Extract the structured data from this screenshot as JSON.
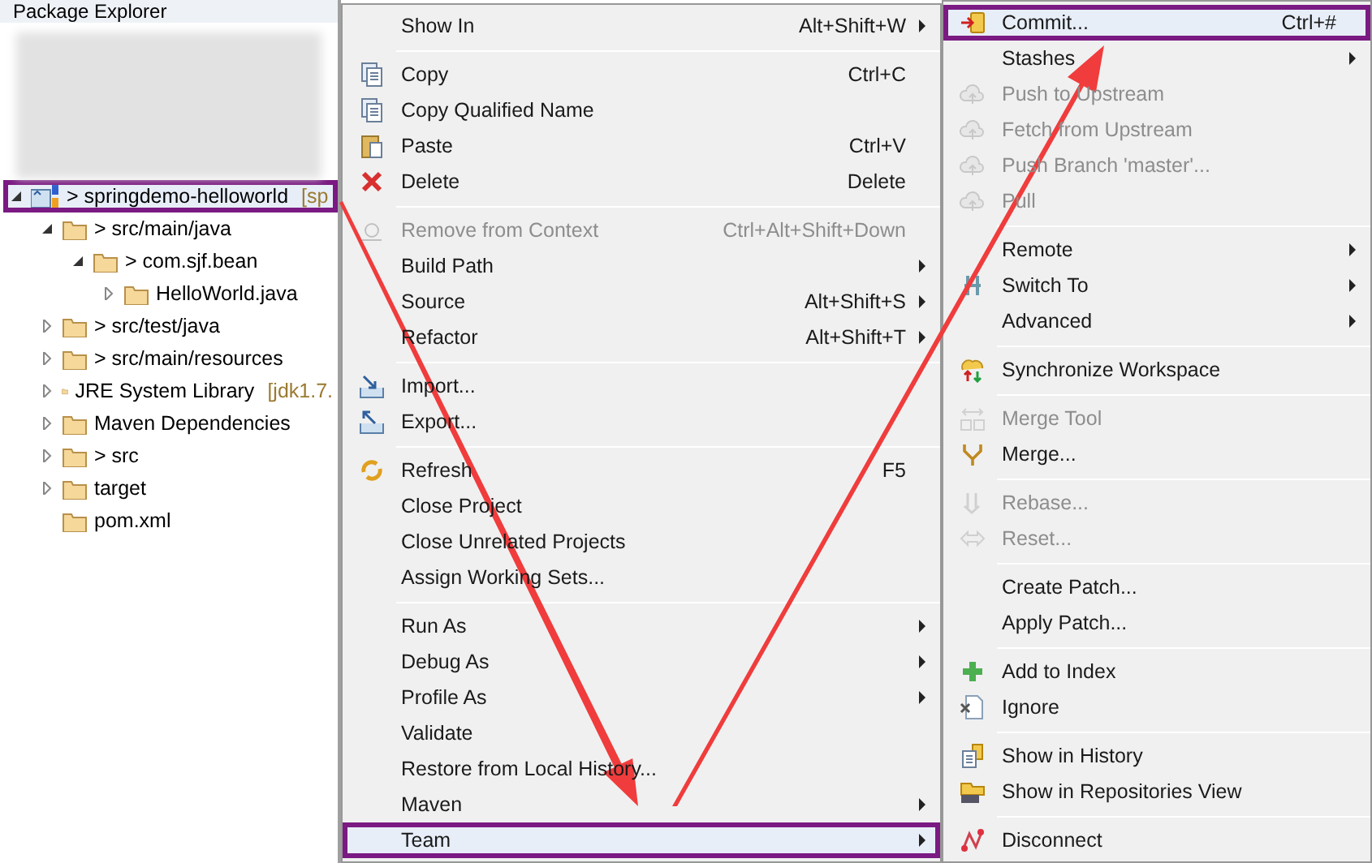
{
  "explorer": {
    "title": "Package Explorer",
    "tree": [
      {
        "label": "> springdemo-helloworld",
        "decoration": "[sp",
        "expanded": true,
        "highlighted": true,
        "children": [
          {
            "label": "> src/main/java",
            "expanded": true,
            "children": [
              {
                "label": "> com.sjf.bean",
                "expanded": true,
                "children": [
                  {
                    "label": "HelloWorld.java",
                    "expanded": false
                  }
                ]
              }
            ]
          },
          {
            "label": "> src/test/java",
            "expanded": false
          },
          {
            "label": "> src/main/resources",
            "expanded": false
          },
          {
            "label": "JRE System Library",
            "decoration": "[jdk1.7.",
            "expanded": false
          },
          {
            "label": "Maven Dependencies",
            "expanded": false
          },
          {
            "label": "> src",
            "expanded": false
          },
          {
            "label": "target",
            "expanded": false
          },
          {
            "label": "pom.xml"
          }
        ]
      }
    ]
  },
  "context_menu": {
    "groups": [
      [
        {
          "label": "Show In",
          "shortcut": "Alt+Shift+W",
          "submenu": true,
          "disabled": false,
          "highlighted": false
        }
      ],
      [
        {
          "label": "Copy",
          "shortcut": "Ctrl+C",
          "submenu": false,
          "disabled": false,
          "highlighted": false
        },
        {
          "label": "Copy Qualified Name",
          "submenu": false,
          "disabled": false,
          "highlighted": false
        },
        {
          "label": "Paste",
          "shortcut": "Ctrl+V",
          "submenu": false,
          "disabled": false,
          "highlighted": false
        },
        {
          "label": "Delete",
          "shortcut": "Delete",
          "submenu": false,
          "disabled": false,
          "highlighted": false
        }
      ],
      [
        {
          "label": "Remove from Context",
          "shortcut": "Ctrl+Alt+Shift+Down",
          "submenu": false,
          "disabled": true,
          "highlighted": false
        },
        {
          "label": "Build Path",
          "submenu": true,
          "disabled": false,
          "highlighted": false
        },
        {
          "label": "Source",
          "shortcut": "Alt+Shift+S",
          "submenu": true,
          "disabled": false,
          "highlighted": false
        },
        {
          "label": "Refactor",
          "shortcut": "Alt+Shift+T",
          "submenu": true,
          "disabled": false,
          "highlighted": false
        }
      ],
      [
        {
          "label": "Import...",
          "submenu": false,
          "disabled": false,
          "highlighted": false
        },
        {
          "label": "Export...",
          "submenu": false,
          "disabled": false,
          "highlighted": false
        }
      ],
      [
        {
          "label": "Refresh",
          "shortcut": "F5",
          "submenu": false,
          "disabled": false,
          "highlighted": false
        },
        {
          "label": "Close Project",
          "submenu": false,
          "disabled": false,
          "highlighted": false
        },
        {
          "label": "Close Unrelated Projects",
          "submenu": false,
          "disabled": false,
          "highlighted": false
        },
        {
          "label": "Assign Working Sets...",
          "submenu": false,
          "disabled": false,
          "highlighted": false
        }
      ],
      [
        {
          "label": "Run As",
          "submenu": true,
          "disabled": false,
          "highlighted": false
        },
        {
          "label": "Debug As",
          "submenu": true,
          "disabled": false,
          "highlighted": false
        },
        {
          "label": "Profile As",
          "submenu": true,
          "disabled": false,
          "highlighted": false
        },
        {
          "label": "Validate",
          "submenu": false,
          "disabled": false,
          "highlighted": false
        },
        {
          "label": "Restore from Local History...",
          "submenu": false,
          "disabled": false,
          "highlighted": false
        },
        {
          "label": "Maven",
          "submenu": true,
          "disabled": false,
          "highlighted": false
        },
        {
          "label": "Team",
          "submenu": true,
          "disabled": false,
          "highlighted": true
        }
      ]
    ]
  },
  "team_menu": {
    "groups": [
      [
        {
          "label": "Commit...",
          "shortcut": "Ctrl+#",
          "submenu": false,
          "disabled": false,
          "highlighted": true
        },
        {
          "label": "Stashes",
          "submenu": true,
          "disabled": false,
          "highlighted": false
        },
        {
          "label": "Push to Upstream",
          "submenu": false,
          "disabled": true,
          "highlighted": false
        },
        {
          "label": "Fetch from Upstream",
          "submenu": false,
          "disabled": true,
          "highlighted": false
        },
        {
          "label": "Push Branch 'master'...",
          "submenu": false,
          "disabled": true,
          "highlighted": false
        },
        {
          "label": "Pull",
          "submenu": false,
          "disabled": true,
          "highlighted": false
        }
      ],
      [
        {
          "label": "Remote",
          "submenu": true,
          "disabled": false,
          "highlighted": false
        },
        {
          "label": "Switch To",
          "submenu": true,
          "disabled": false,
          "highlighted": false
        },
        {
          "label": "Advanced",
          "submenu": true,
          "disabled": false,
          "highlighted": false
        }
      ],
      [
        {
          "label": "Synchronize Workspace",
          "submenu": false,
          "disabled": false,
          "highlighted": false
        }
      ],
      [
        {
          "label": "Merge Tool",
          "submenu": false,
          "disabled": true,
          "highlighted": false
        },
        {
          "label": "Merge...",
          "submenu": false,
          "disabled": false,
          "highlighted": false
        }
      ],
      [
        {
          "label": "Rebase...",
          "submenu": false,
          "disabled": true,
          "highlighted": false
        },
        {
          "label": "Reset...",
          "submenu": false,
          "disabled": true,
          "highlighted": false
        }
      ],
      [
        {
          "label": "Create Patch...",
          "submenu": false,
          "disabled": false,
          "highlighted": false
        },
        {
          "label": "Apply Patch...",
          "submenu": false,
          "disabled": false,
          "highlighted": false
        }
      ],
      [
        {
          "label": "Add to Index",
          "submenu": false,
          "disabled": false,
          "highlighted": false
        },
        {
          "label": "Ignore",
          "submenu": false,
          "disabled": false,
          "highlighted": false
        }
      ],
      [
        {
          "label": "Show in History",
          "submenu": false,
          "disabled": false,
          "highlighted": false
        },
        {
          "label": "Show in Repositories View",
          "submenu": false,
          "disabled": false,
          "highlighted": false
        }
      ],
      [
        {
          "label": "Disconnect",
          "submenu": false,
          "disabled": false,
          "highlighted": false
        }
      ]
    ]
  }
}
